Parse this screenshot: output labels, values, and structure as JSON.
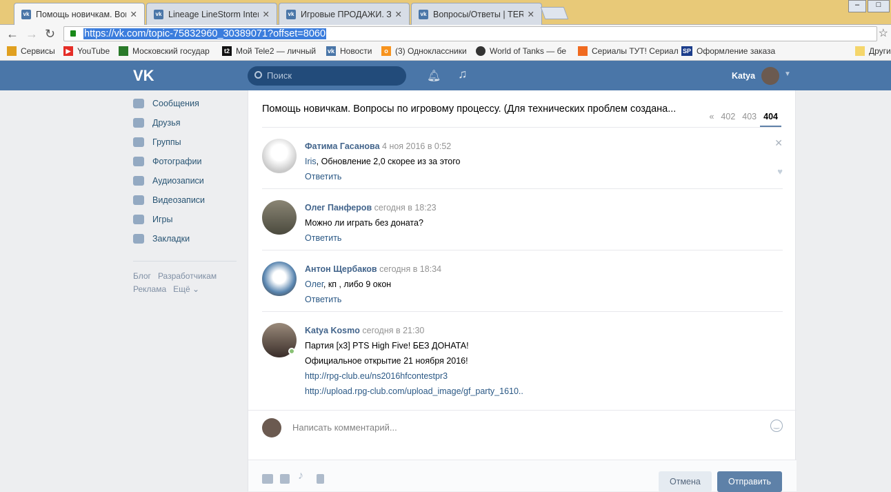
{
  "browser": {
    "tabs": [
      {
        "title": "Помощь новичкам. Вопр",
        "active": true
      },
      {
        "title": "Lineage LineStorm Interlu"
      },
      {
        "title": "Игровые ПРОДАЖИ. За"
      },
      {
        "title": "Вопросы/Ответы | TERA"
      }
    ],
    "url": "https://vk.com/topic-75832960_30389071?offset=8060",
    "bookmarks": [
      {
        "label": "Сервисы",
        "icon": "apps-icon",
        "color": "#e0a020"
      },
      {
        "label": "YouTube",
        "icon": "youtube-icon",
        "color": "#e52d27"
      },
      {
        "label": "Московский государ",
        "icon": "msu-icon",
        "color": "#2a7a2a"
      },
      {
        "label": "Мой Tele2 — личный",
        "icon": "tele2-icon",
        "color": "#111111"
      },
      {
        "label": "Новости",
        "icon": "vk-icon",
        "color": "#4a76a8"
      },
      {
        "label": "(3) Одноклассники",
        "icon": "ok-icon",
        "color": "#f7931e"
      },
      {
        "label": "World of Tanks — бе",
        "icon": "wot-icon",
        "color": "#333333"
      },
      {
        "label": "Сериалы ТУТ! Сериал",
        "icon": "cat-icon",
        "color": "#f06a20"
      },
      {
        "label": "Оформление заказа",
        "icon": "sp-icon",
        "color": "#1b3c8a"
      }
    ],
    "other_bookmarks": "Други"
  },
  "header": {
    "logo": "VK",
    "search_placeholder": "Поиск",
    "user_name": "Katya"
  },
  "sidebar": {
    "items": [
      {
        "label": "Сообщения"
      },
      {
        "label": "Друзья"
      },
      {
        "label": "Группы"
      },
      {
        "label": "Фотографии"
      },
      {
        "label": "Аудиозаписи"
      },
      {
        "label": "Видеозаписи"
      },
      {
        "label": "Игры"
      },
      {
        "label": "Закладки"
      }
    ],
    "footer": [
      "Блог",
      "Разработчикам",
      "Реклама",
      "Ещё ⌄"
    ]
  },
  "topic": {
    "title": "Помощь новичкам. Вопросы по игровому процессу. (Для технических проблем создана...",
    "pages": [
      "«",
      "402",
      "403",
      "404"
    ],
    "current_page": "404"
  },
  "posts": [
    {
      "author": "Фатима Гасанова",
      "date": "4 ноя 2016 в 0:52",
      "mention": "Iris",
      "lines": [
        ", Обновление 2,0 скорее из за этого"
      ],
      "reply": "Ответить",
      "avatar_color": "#d8d8d8"
    },
    {
      "author": "Олег Панферов",
      "date": "сегодня в 18:23",
      "mention": "",
      "lines": [
        "Можно ли играть без доната?"
      ],
      "reply": "Ответить",
      "avatar_color": "#6b6656"
    },
    {
      "author": "Антон Щербаков",
      "date": "сегодня в 18:34",
      "mention": "Олег",
      "lines": [
        ", кп , либо 9 окон"
      ],
      "reply": "Ответить",
      "avatar_color": "#5a86b0"
    },
    {
      "author": "Katya Kosmo",
      "date": "сегодня в 21:30",
      "mention": "",
      "lines": [
        "Партия [x3] PTS High Five! БЕЗ ДОНАТА!",
        "Официальное открытие 21 ноября 2016!"
      ],
      "links": [
        "http://rpg-club.eu/ns2016hfcontestpr3",
        "http://upload.rpg-club.com/upload_image/gf_party_1610.."
      ],
      "avatar_color": "#5a4a44"
    }
  ],
  "composer": {
    "placeholder": "Написать комментарий...",
    "cancel": "Отмена",
    "send": "Отправить"
  }
}
